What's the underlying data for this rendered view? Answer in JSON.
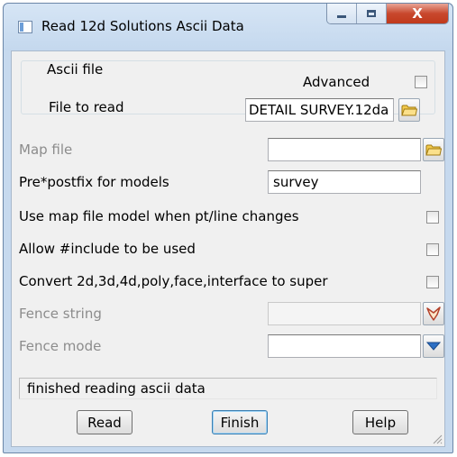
{
  "window": {
    "title": "Read 12d Solutions Ascii Data"
  },
  "titlebar_controls": {
    "minimize": "minimize",
    "maximize": "maximize",
    "close_glyph": "X"
  },
  "ascii_group": {
    "legend": "Ascii file",
    "advanced_label": "Advanced",
    "advanced_checked": false,
    "file_label": "File to read",
    "file_value": "DETAIL SURVEY.12da"
  },
  "map_file": {
    "label": "Map file",
    "value": "",
    "enabled": false
  },
  "prefix": {
    "label": "Pre*postfix for models",
    "value": "survey"
  },
  "options": [
    {
      "label": "Use map file model when pt/line changes",
      "checked": false
    },
    {
      "label": "Allow #include to be used",
      "checked": false
    },
    {
      "label": "Convert 2d,3d,4d,poly,face,interface to super",
      "checked": false
    }
  ],
  "fence_string": {
    "label": "Fence string",
    "value": "",
    "enabled": false
  },
  "fence_mode": {
    "label": "Fence mode",
    "value": "",
    "enabled": false
  },
  "status": "finished reading ascii data",
  "buttons": {
    "read": "Read",
    "finish": "Finish",
    "help": "Help"
  },
  "icons": {
    "window": "app-window-icon",
    "file_browse": "folder-icon",
    "map_browse": "folder-icon",
    "fence_pick": "string-pick-icon",
    "fence_dropdown": "chevron-down-icon",
    "resize": "resize-grip-icon"
  },
  "colors": {
    "folder": "#f2c94c",
    "dropdown_arrow": "#2d6fc4",
    "close_button": "#c8482d"
  }
}
